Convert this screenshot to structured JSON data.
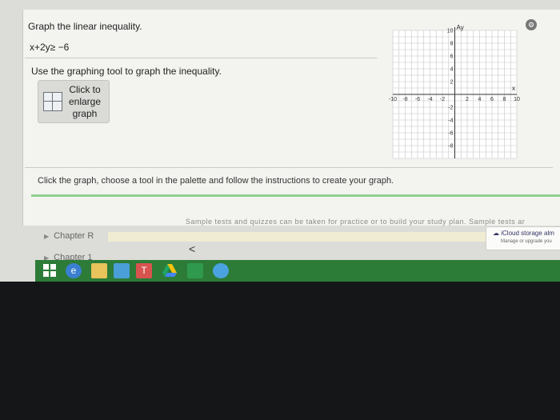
{
  "question": {
    "title": "Graph the linear inequality.",
    "inequality": "x+2y≥ −6",
    "instruction": "Use the graphing tool to graph the inequality.",
    "enlarge_label": "Click to enlarge graph"
  },
  "graph": {
    "y_axis_label": "Ay",
    "x_axis_label": "x",
    "x_ticks": [
      "-10",
      "-8",
      "-6",
      "-4",
      "-2",
      "2",
      "4",
      "6",
      "8",
      "10"
    ],
    "y_ticks": [
      "10",
      "8",
      "6",
      "4",
      "2",
      "-2",
      "-4",
      "-6",
      "-8"
    ],
    "xlim": [
      -10,
      10
    ],
    "ylim": [
      -10,
      10
    ],
    "grid": true
  },
  "instruction_bar": "Click the graph, choose a tool in the palette and follow the instructions to create your graph.",
  "background": {
    "cut_text": "Sample tests and quizzes can be taken for practice or to build your study plan. Sample tests ar",
    "chapter_r": "Chapter R",
    "chapter_1": "Chapter 1",
    "back_arrow": "<"
  },
  "notification": {
    "title": "iCloud storage alm",
    "subtitle": "Manage or upgrade you"
  },
  "colors": {
    "taskbar": "#2c7b37",
    "accent_green": "#8fd28f"
  },
  "taskbar": {
    "icons": [
      "windows-start-icon",
      "internet-explorer-icon",
      "file-explorer-icon",
      "store-icon",
      "t-app-icon",
      "google-drive-icon",
      "office-icon",
      "cloud-app-icon"
    ]
  }
}
